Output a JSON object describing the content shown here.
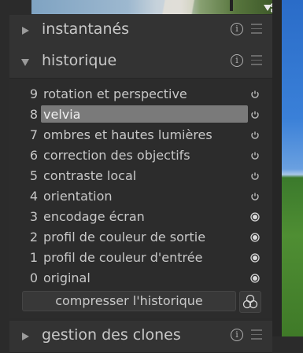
{
  "sections": {
    "snapshots": {
      "title": "instantanés",
      "collapsed": true
    },
    "history": {
      "title": "historique",
      "collapsed": false
    },
    "duplicates": {
      "title": "gestion des clones",
      "collapsed": true
    }
  },
  "history": {
    "items": [
      {
        "num": "9",
        "label": "rotation et perspective",
        "status": "power-icon"
      },
      {
        "num": "8",
        "label": "velvia",
        "status": "power-icon",
        "selected": true
      },
      {
        "num": "7",
        "label": "ombres et hautes lumières",
        "status": "power-icon"
      },
      {
        "num": "6",
        "label": "correction des objectifs",
        "status": "power-icon"
      },
      {
        "num": "5",
        "label": "contraste local",
        "status": "power-icon"
      },
      {
        "num": "4",
        "label": "orientation",
        "status": "power-icon"
      },
      {
        "num": "3",
        "label": "encodage écran",
        "status": "always-on-icon"
      },
      {
        "num": "2",
        "label": "profil de couleur de sortie",
        "status": "always-on-icon"
      },
      {
        "num": "1",
        "label": "profil de couleur d'entrée",
        "status": "always-on-icon"
      },
      {
        "num": "0",
        "label": "original",
        "status": "always-on-icon"
      }
    ],
    "compress_label": "compresser l'historique"
  },
  "colors": {
    "panel": "#2c2c2c",
    "header": "#333333",
    "selected": "#7a7a7a",
    "text": "#c8c8c8"
  }
}
